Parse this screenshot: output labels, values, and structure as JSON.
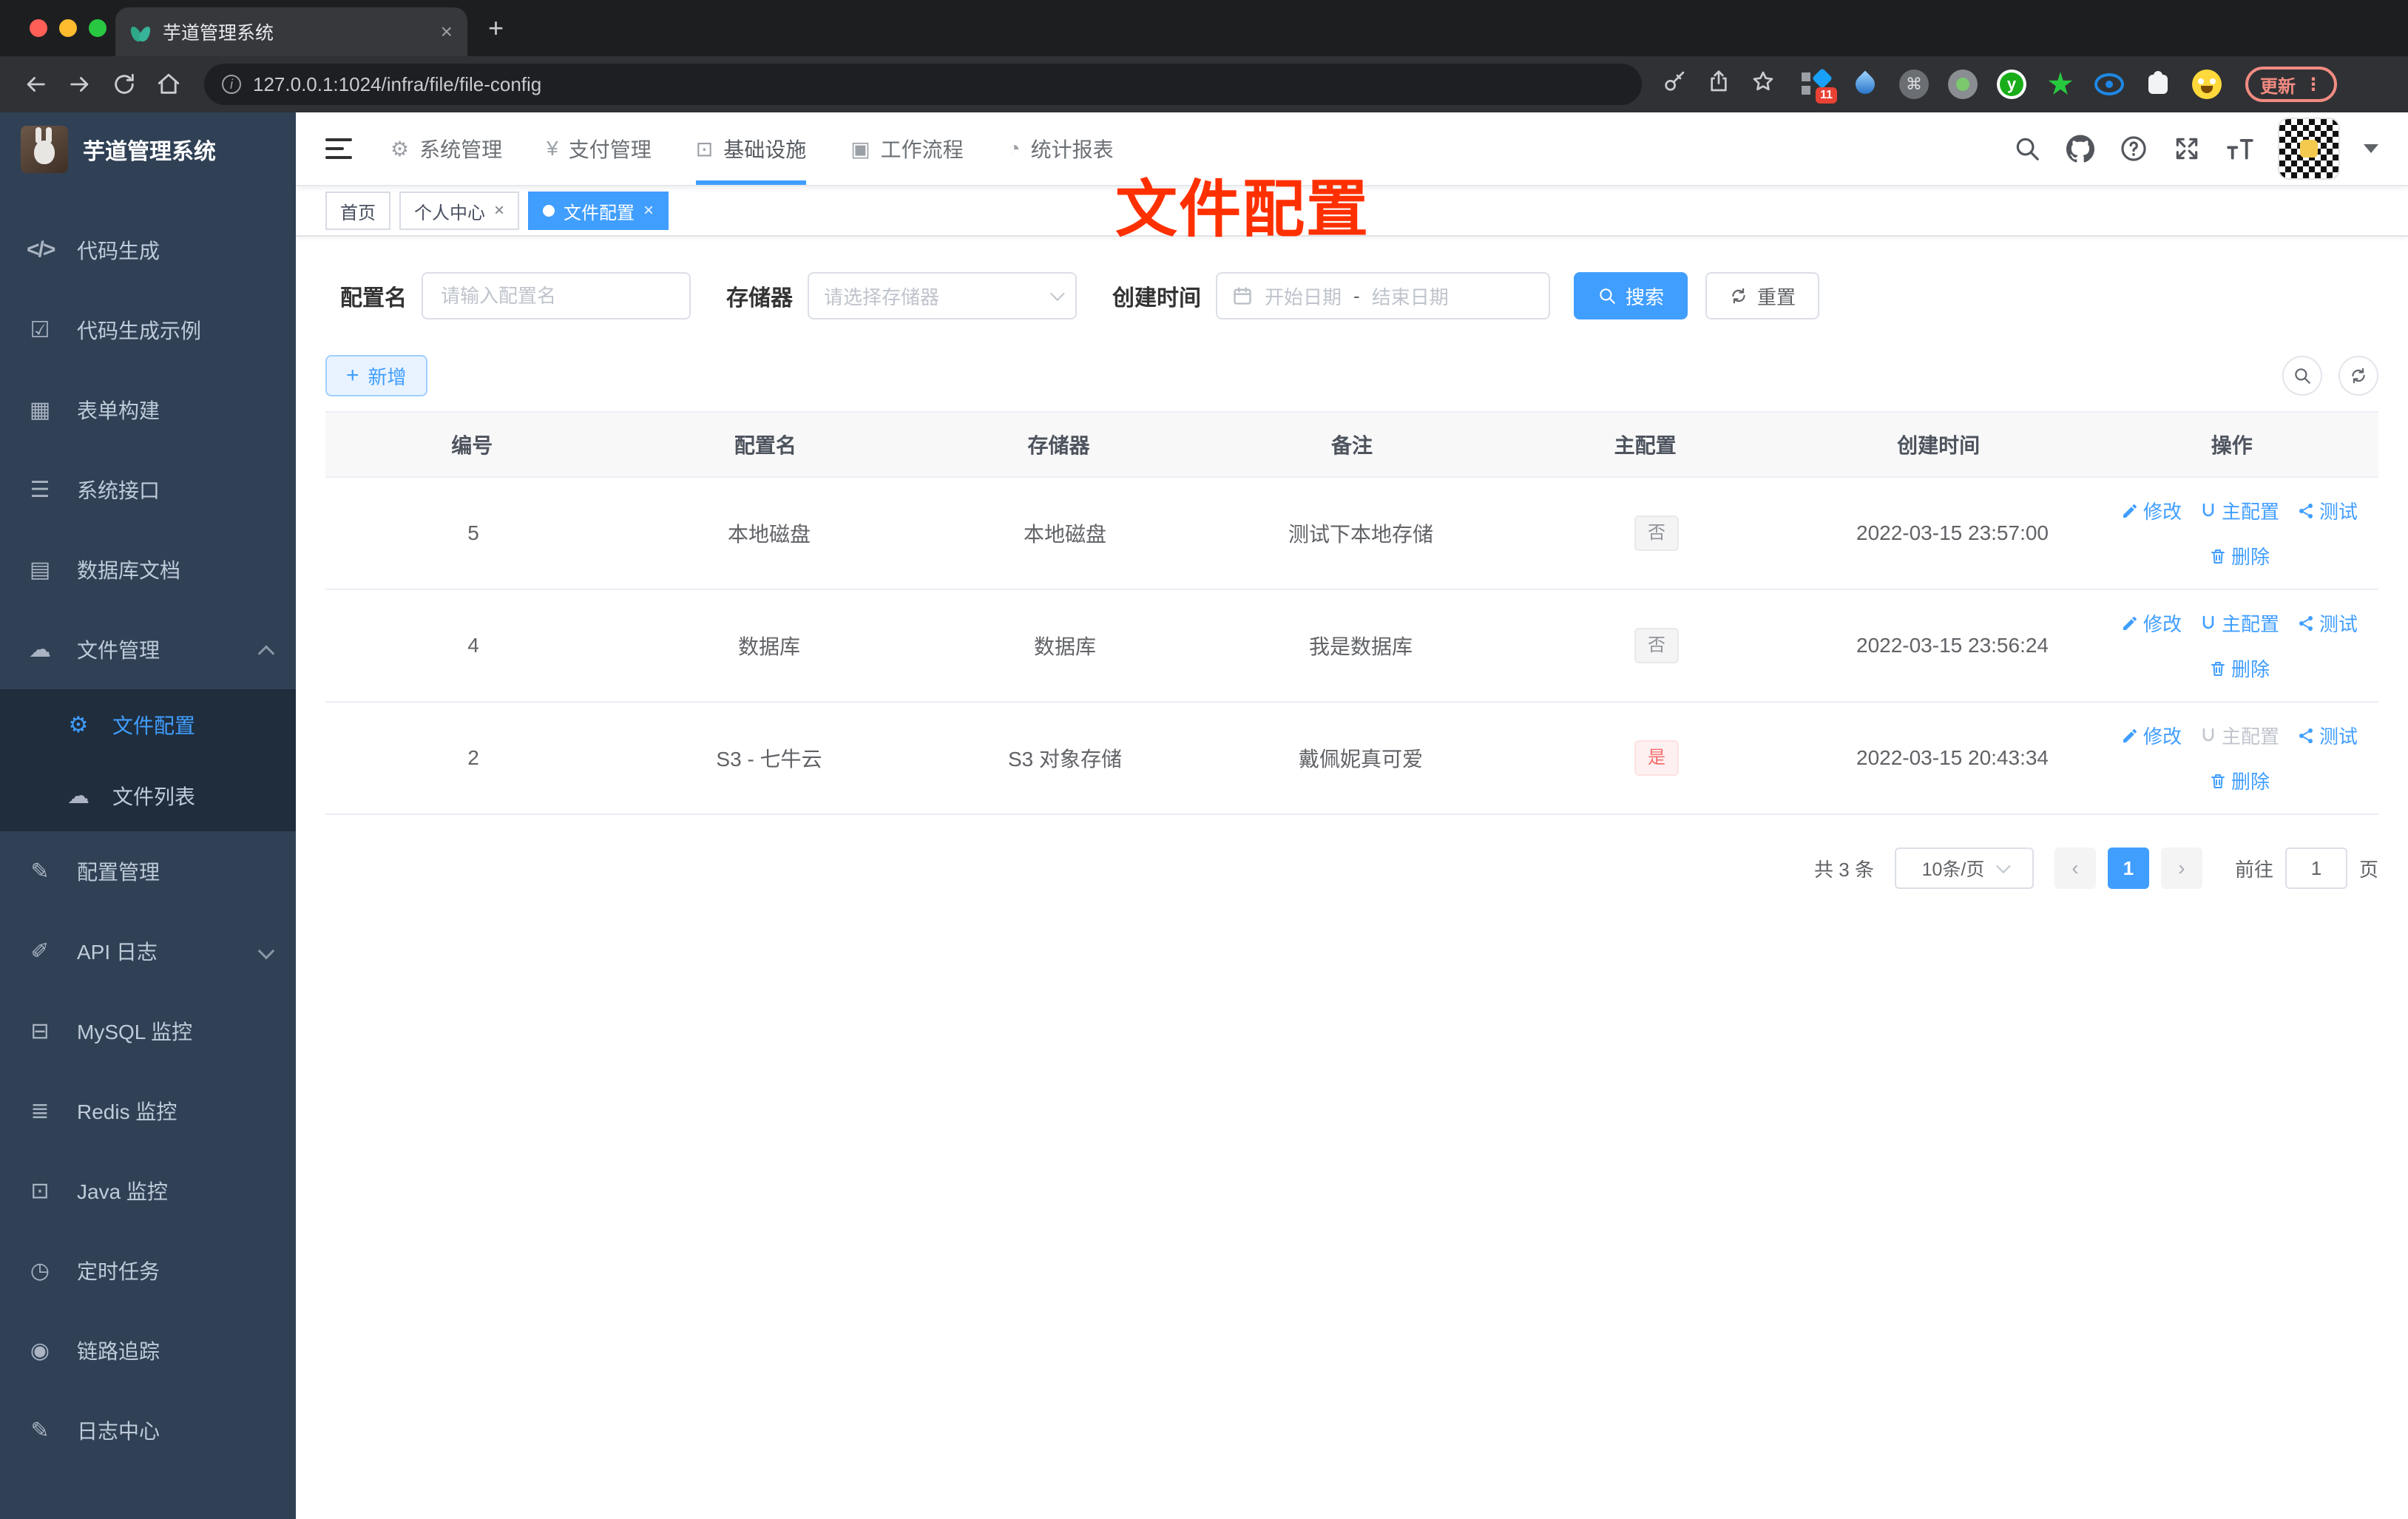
{
  "browser": {
    "tab_title": "芋道管理系统",
    "url": "127.0.0.1:1024/infra/file/file-config",
    "new_tab": "+",
    "close_tab": "×",
    "update_label": "更新",
    "menu_dots": "⋮",
    "extensions": [
      {
        "name": "pin-grid",
        "badge": "11"
      },
      {
        "name": "drop"
      },
      {
        "name": "command",
        "glyph": "⌘"
      },
      {
        "name": "record"
      },
      {
        "name": "letter-y",
        "glyph": "y"
      },
      {
        "name": "star-green"
      },
      {
        "name": "eye-blue"
      },
      {
        "name": "puzzle"
      },
      {
        "name": "smiley"
      }
    ]
  },
  "sidebar": {
    "title": "芋道管理系统",
    "items": [
      {
        "label": "代码生成",
        "icon": "code-icon",
        "glyph": "</>",
        "code": true
      },
      {
        "label": "代码生成示例",
        "icon": "shield-check-icon",
        "glyph": "☑"
      },
      {
        "label": "表单构建",
        "icon": "form-grid-icon",
        "glyph": "▦"
      },
      {
        "label": "系统接口",
        "icon": "sliders-icon",
        "glyph": "☰"
      },
      {
        "label": "数据库文档",
        "icon": "table-doc-icon",
        "glyph": "▤"
      },
      {
        "label": "文件管理",
        "icon": "cloud-download-icon",
        "glyph": "☁",
        "caret": "up"
      },
      {
        "label": "文件配置",
        "icon": "gear-icon",
        "glyph": "⚙",
        "sub": true,
        "active": true
      },
      {
        "label": "文件列表",
        "icon": "cloud-upload-icon",
        "glyph": "☁",
        "sub": true
      },
      {
        "label": "配置管理",
        "icon": "edit-square-icon",
        "glyph": "✎"
      },
      {
        "label": "API 日志",
        "icon": "log-edit-icon",
        "glyph": "✐",
        "caret": "down"
      },
      {
        "label": "MySQL 监控",
        "icon": "mysql-monitor-icon",
        "glyph": "⊟"
      },
      {
        "label": "Redis 监控",
        "icon": "redis-layers-icon",
        "glyph": "≣"
      },
      {
        "label": "Java 监控",
        "icon": "java-monitor-icon",
        "glyph": "⊡"
      },
      {
        "label": "定时任务",
        "icon": "timer-icon",
        "glyph": "◷"
      },
      {
        "label": "链路追踪",
        "icon": "eye-icon",
        "glyph": "◉"
      },
      {
        "label": "日志中心",
        "icon": "log-center-icon",
        "glyph": "✎"
      }
    ]
  },
  "app_header": {
    "nav": [
      {
        "label": "系统管理",
        "icon": "gear-icon",
        "glyph": "⚙"
      },
      {
        "label": "支付管理",
        "icon": "yen-icon",
        "glyph": "¥"
      },
      {
        "label": "基础设施",
        "icon": "monitor-icon",
        "glyph": "⊡",
        "active": true
      },
      {
        "label": "工作流程",
        "icon": "briefcase-icon",
        "glyph": "▣"
      },
      {
        "label": "统计报表",
        "icon": "dashboard-icon",
        "glyph": "◔"
      }
    ]
  },
  "tags": [
    {
      "label": "首页"
    },
    {
      "label": "个人中心",
      "closable": true
    },
    {
      "label": "文件配置",
      "closable": true,
      "active": true
    }
  ],
  "annotation": "文件配置",
  "filter": {
    "name_label": "配置名",
    "name_placeholder": "请输入配置名",
    "storage_label": "存储器",
    "storage_placeholder": "请选择存储器",
    "date_label": "创建时间",
    "date_start": "开始日期",
    "date_sep": "-",
    "date_end": "结束日期",
    "search_label": "搜索",
    "reset_label": "重置"
  },
  "toolbar": {
    "add_label": "新增"
  },
  "table": {
    "columns": [
      "编号",
      "配置名",
      "存储器",
      "备注",
      "主配置",
      "创建时间",
      "操作"
    ],
    "action_labels": {
      "edit": "修改",
      "master": "主配置",
      "test": "测试",
      "delete": "删除"
    },
    "rows": [
      {
        "id": "5",
        "name": "本地磁盘",
        "storage": "本地磁盘",
        "remark": "测试下本地存储",
        "master": "否",
        "master_type": "info",
        "created": "2022-03-15 23:57:00",
        "master_action_disabled": false
      },
      {
        "id": "4",
        "name": "数据库",
        "storage": "数据库",
        "remark": "我是数据库",
        "master": "否",
        "master_type": "info",
        "created": "2022-03-15 23:56:24",
        "master_action_disabled": false
      },
      {
        "id": "2",
        "name": "S3 - 七牛云",
        "storage": "S3 对象存储",
        "remark": "戴佩妮真可爱",
        "master": "是",
        "master_type": "danger",
        "created": "2022-03-15 20:43:34",
        "master_action_disabled": true
      }
    ]
  },
  "pagination": {
    "total": "共 3 条",
    "size": "10条/页",
    "page": "1",
    "goto": "前往",
    "goto_value": "1",
    "unit": "页"
  }
}
